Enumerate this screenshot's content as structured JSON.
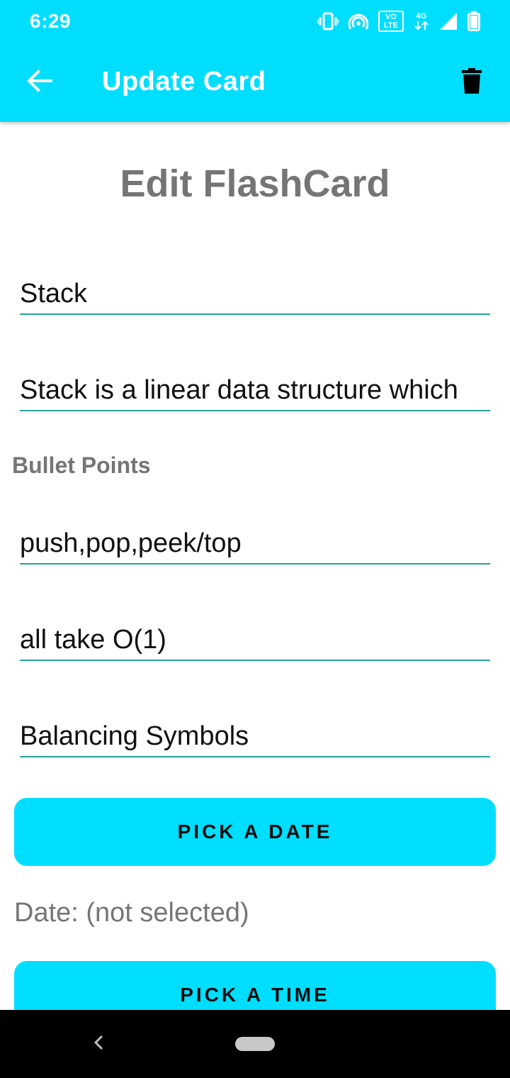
{
  "status_bar": {
    "time": "6:29",
    "icons": [
      "vibrate-icon",
      "hotspot-icon",
      "volte-icon",
      "4g-data-icon",
      "signal-icon",
      "battery-icon"
    ],
    "volte_top": "VO",
    "volte_bottom": "LTE",
    "network_label": "4G"
  },
  "app_bar": {
    "title": "Update Card",
    "back_icon": "arrow-back-icon",
    "delete_icon": "trash-icon",
    "background": "#00DEFF"
  },
  "form": {
    "heading": "Edit FlashCard",
    "title_value": "Stack",
    "description_value": "Stack is a linear data structure which",
    "bullet_section_label": "Bullet Points",
    "bullets": [
      "push,pop,peek/top",
      "all take O(1)",
      "Balancing Symbols"
    ],
    "pick_date_label": "PICK A DATE",
    "date_status": "Date: (not selected)",
    "pick_time_label": "PICK A TIME"
  },
  "colors": {
    "accent": "#00DEFF",
    "underline": "#27A39A",
    "muted_text": "#757575"
  }
}
